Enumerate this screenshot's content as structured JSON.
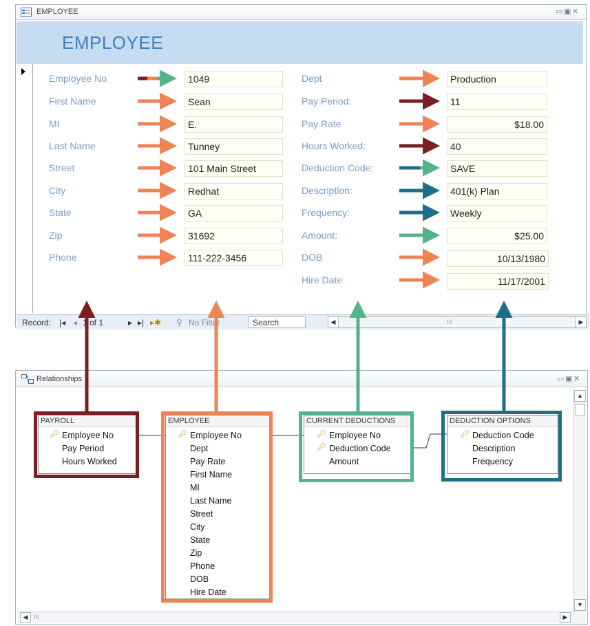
{
  "form_window": {
    "title": "EMPLOYEE",
    "header_title": "EMPLOYEE",
    "icon": "form-icon",
    "window_controls": [
      "minimize",
      "restore",
      "close"
    ]
  },
  "left_fields": [
    {
      "label": "Employee No",
      "value": "1049"
    },
    {
      "label": "First Name",
      "value": "Sean"
    },
    {
      "label": "MI",
      "value": "E."
    },
    {
      "label": "Last Name",
      "value": "Tunney"
    },
    {
      "label": "Street",
      "value": "101 Main Street"
    },
    {
      "label": "City",
      "value": "Redhat"
    },
    {
      "label": "State",
      "value": "GA"
    },
    {
      "label": "Zip",
      "value": "31692"
    },
    {
      "label": "Phone",
      "value": "111-222-3456"
    }
  ],
  "right_fields": [
    {
      "label": "Dept",
      "value": "Production"
    },
    {
      "label": "Pay Period:",
      "value": "11"
    },
    {
      "label": "Pay Rate",
      "value": "$18.00"
    },
    {
      "label": "Hours Worked:",
      "value": "40"
    },
    {
      "label": "Deduction Code:",
      "value": "SAVE"
    },
    {
      "label": "Description:",
      "value": "401(k) Plan"
    },
    {
      "label": "Frequency:",
      "value": "Weekly"
    },
    {
      "label": "Amount:",
      "value": "$25.00"
    },
    {
      "label": "DOB",
      "value": "10/13/1980"
    },
    {
      "label": "Hire Date",
      "value": "11/17/2001"
    }
  ],
  "navigation": {
    "record_label": "Record:",
    "position": "1 of 1",
    "filter_label": "No Filter",
    "search_placeholder": "Search",
    "scroll_marker": "III"
  },
  "relationships_window": {
    "title": "Relationships",
    "tables": {
      "payroll": {
        "name": "PAYROLL",
        "fields": [
          "Employee No",
          "Pay Period",
          "Hours Worked"
        ],
        "keys": [
          "Employee No"
        ]
      },
      "employee": {
        "name": "EMPLOYEE",
        "fields": [
          "Employee No",
          "Dept",
          "Pay Rate",
          "First Name",
          "MI",
          "Last Name",
          "Street",
          "City",
          "State",
          "Zip",
          "Phone",
          "DOB",
          "Hire Date"
        ],
        "keys": [
          "Employee No"
        ]
      },
      "current_deductions": {
        "name": "CURRENT DEDUCTIONS",
        "fields": [
          "Employee No",
          "Deduction Code",
          "Amount"
        ],
        "keys": [
          "Employee No",
          "Deduction Code"
        ]
      },
      "deduction_options": {
        "name": "DEDUCTION OPTIONS",
        "fields": [
          "Deduction Code",
          "Description",
          "Frequency"
        ],
        "keys": [
          "Deduction Code"
        ]
      }
    },
    "scroll_marker": "III"
  },
  "colors": {
    "payroll": "#7a1e24",
    "employee": "#ee8456",
    "current_deductions": "#55b28a",
    "deduction_options": "#1f6f8b",
    "header_band": "#c6dcf1",
    "title_blue": "#3e7fbf",
    "label_blue": "#7a9cc8"
  }
}
